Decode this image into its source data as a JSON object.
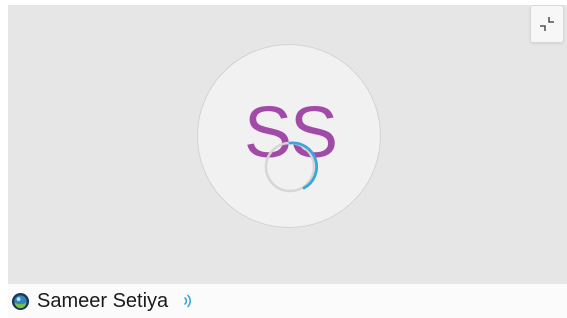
{
  "participant": {
    "initials": "SS",
    "name": "Sameer Setiya"
  },
  "icons": {
    "collapse": "collapse-arrows-icon",
    "status": "status-orb-icon",
    "audio": "audio-indicator-icon",
    "spinner": "loading-spinner-icon"
  },
  "colors": {
    "initials": "#a24aa8",
    "spinner_accent": "#3aa7d8",
    "audio": "#3aa7d8"
  }
}
